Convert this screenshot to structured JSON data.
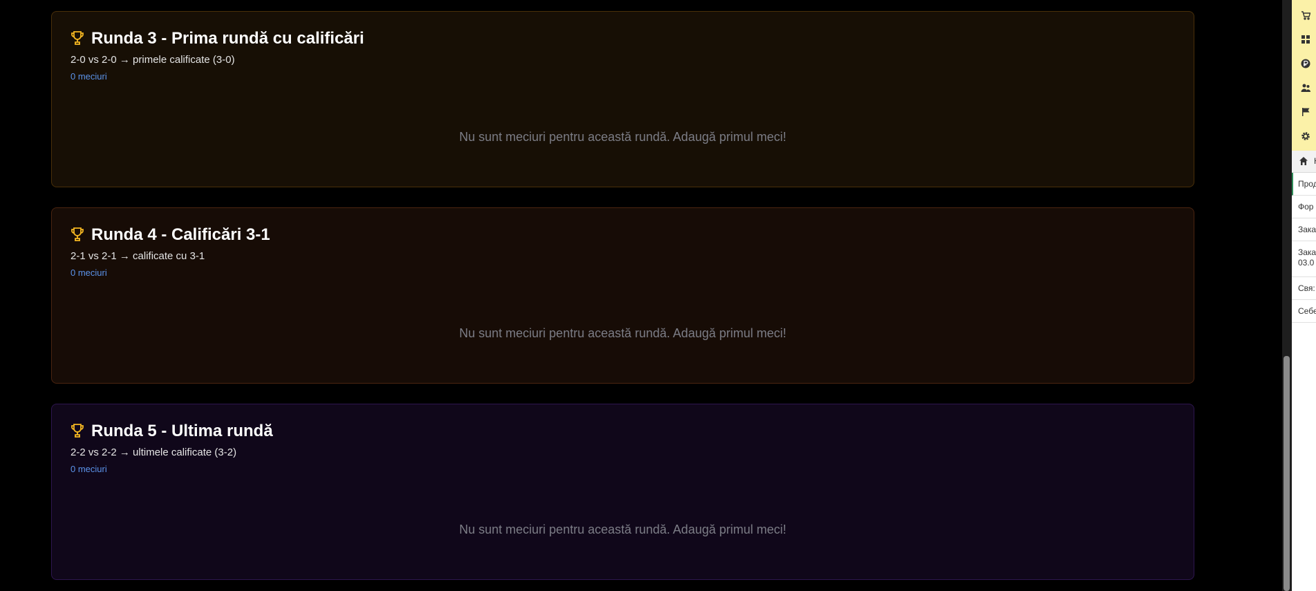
{
  "rounds": [
    {
      "title": "Runda 3 - Prima rundă cu calificări",
      "description": "2-0 vs 2-0 → primele calificate (3-0)",
      "match_count": "0 meciuri",
      "empty_message": "Nu sunt meciuri pentru această rundă. Adaugă primul meci!",
      "accent": "#4a3009"
    },
    {
      "title": "Runda 4 - Calificări 3-1",
      "description": "2-1 vs 2-1 → calificate cu 3-1",
      "match_count": "0 meciuri",
      "empty_message": "Nu sunt meciuri pentru această rundă. Adaugă primul meci!",
      "accent": "#4b2410"
    },
    {
      "title": "Runda 5 - Ultima rundă",
      "description": "2-2 vs 2-2 → ultimele calificate (3-2)",
      "match_count": "0 meciuri",
      "empty_message": "Nu sunt meciuri pentru această rundă. Adaugă primul meci!",
      "accent": "#2e1650"
    }
  ],
  "icons": {
    "round": "trophy-icon",
    "side": [
      "cart-icon",
      "grid-icon",
      "ruble-icon",
      "users-icon",
      "flag-icon",
      "gear-icon",
      "home-icon"
    ]
  },
  "side_panel": {
    "home_label": "Н",
    "items": [
      "Прод",
      "Фор",
      "Зака",
      "Зака 03.0",
      "Свя:",
      "Себе"
    ]
  },
  "colors": {
    "title": "#ffffff",
    "trophy": "#f6b822",
    "count_link": "#5b93ea",
    "empty_text": "#7c7d86",
    "side_top_bg": "#fbf1a8"
  }
}
